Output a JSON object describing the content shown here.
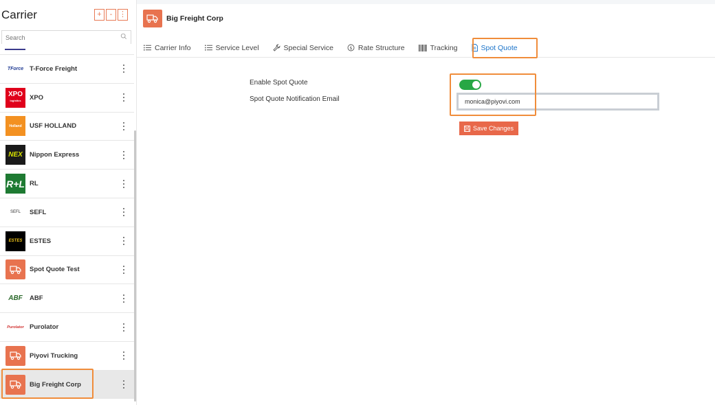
{
  "sidebar": {
    "title": "Carrier",
    "actions": {
      "add": "+",
      "collapse": "-",
      "more": "⋮"
    },
    "search_placeholder": "Search",
    "items": [
      {
        "label": "T-Force Freight",
        "logo_text": "TForce"
      },
      {
        "label": "XPO",
        "logo_text": "XPO",
        "logo_sub": "logistics"
      },
      {
        "label": "USF HOLLAND",
        "logo_text": "Holland"
      },
      {
        "label": "Nippon Express",
        "logo_text": "NEX"
      },
      {
        "label": "RL",
        "logo_text": "R+L"
      },
      {
        "label": "SEFL",
        "logo_text": "SEFL"
      },
      {
        "label": "ESTES",
        "logo_text": "ESTES"
      },
      {
        "label": "Spot Quote Test"
      },
      {
        "label": "ABF",
        "logo_text": "ABF"
      },
      {
        "label": "Purolator",
        "logo_text": "Purolator"
      },
      {
        "label": "Piyovi Trucking"
      },
      {
        "label": "Big Freight Corp"
      }
    ]
  },
  "header": {
    "title": "Big Freight Corp"
  },
  "tabs": [
    {
      "label": "Carrier Info",
      "icon": "list-icon"
    },
    {
      "label": "Service Level",
      "icon": "list-icon"
    },
    {
      "label": "Special Service",
      "icon": "wrench-icon"
    },
    {
      "label": "Rate Structure",
      "icon": "dollar-circle-icon"
    },
    {
      "label": "Tracking",
      "icon": "barcode-icon"
    },
    {
      "label": "Spot Quote",
      "icon": "document-icon"
    }
  ],
  "form": {
    "enable_label": "Enable Spot Quote",
    "enable_value": true,
    "email_label": "Spot Quote Notification Email",
    "email_value": "monica@piyovi.com",
    "save_label": "Save Changes"
  },
  "colors": {
    "accent": "#e8734f",
    "highlight": "#f08c3a",
    "toggle_on": "#28a745",
    "active_tab": "#1a73c9"
  }
}
